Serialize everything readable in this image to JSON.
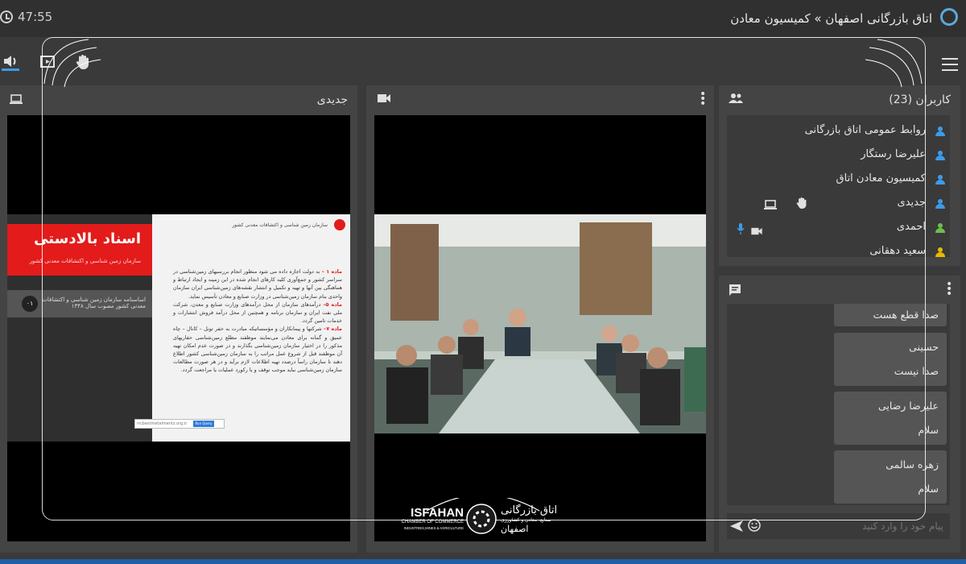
{
  "header": {
    "timer": "47:55",
    "title": "اتاق بازرگانی اصفهان » کمیسیون معادن"
  },
  "toolbar": {
    "audio_icon": "speaker-icon",
    "screenshare_icon": "screen-share-icon",
    "hand_icon": "raise-hand-icon",
    "menu_icon": "hamburger-icon"
  },
  "presentation": {
    "title": "جدیدی",
    "slide": {
      "big_title": "اسناد بالادستی",
      "red_subtitle": "سازمان زمین شناسی و اکتشافات معدنی کشور",
      "grey_text": "اساسنامه سازمان زمین شناسی و اکتشافات معدنی کشور مصوب سال ۱۳۴۸",
      "grey_num": "۰۱",
      "header_text": "سازمان زمین شناسی و اکتشافات معدنی کشور",
      "p1_label": "ماده ۱ –",
      "p1_text": " به دولت اجازه داده می شود منظور انجام بررسیهای زمین‌شناسی در سراسر کشور و جمع‌آوری کلیه کارهای انجام شده در این زمینه و ایجاد ارتباط و هماهنگی بین آنها و تهیه و تکمیل و انتشار نقشه‌های زمین‌شناسی ایران سازمان واحدی بنام سازمان زمین‌شناسی در وزارت صنایع و معادن تأسیس نماید.",
      "p2_label": "ماده ۵–",
      "p2_text": " درآمدهای سازمان از محل درآمدهای وزارت صنایع و معدن، شرکت ملی نفت ایران و سازمان برنامه و همچنین از محل درآمد فروش انتشارات و خدمات تامین گردد.",
      "p3_label": "ماده ۷–",
      "p3_text": " شرکتها و پیمانکاران و مؤسساتیکه مبادرت به حفر تونل – کانال – چاه عمیق و گمانه برای معادن می‌نمایند موظفند مطلع زمین‌شناسی حفاریهای مذکور را در اختیار سازمان زمین‌شناسی بگذارند و در صورت عدم امکان تهیه آن موظفند قبل از شروع عمل مراتب را به سازمان زمین‌شناسی کشور اطلاع دهند تا سازمان راساً درصدد تهیه اطلاعات لازم برآید و در هر صورت مطالعات سازمان زمین‌شناسی نباید موجب توقف و یا رکورد عملیات یا مراجعت گردد.",
      "search_text": "rrcbestmetalmentz.org.ir",
      "search_button": "Run Query"
    }
  },
  "video": {
    "camera_icon": "video-camera-icon"
  },
  "users": {
    "title": "کاربران (23)",
    "items": [
      {
        "name": "روابط عمومی اتاق بازرگانی",
        "color": "#3d9be9"
      },
      {
        "name": "علیرضا رستگار",
        "color": "#3d9be9"
      },
      {
        "name": "کمیسیون معادن اتاق",
        "color": "#3d9be9"
      },
      {
        "name": "جدیدی",
        "color": "#3d9be9"
      },
      {
        "name": "احمدی",
        "color": "#6cc04a"
      },
      {
        "name": "سعید دهقانی",
        "color": "#e6b800"
      }
    ]
  },
  "chat": {
    "messages": [
      {
        "sender": "",
        "text": "صدا قطع هست"
      },
      {
        "sender": "حسینی",
        "text": "صدا نیست"
      },
      {
        "sender": "علیرضا رضایی",
        "text": "سلام"
      },
      {
        "sender": "زهره سالمی",
        "text": "سلام"
      }
    ],
    "placeholder": "پیام خود را وارد کنید"
  },
  "brand": {
    "en_line1": "ISFAHAN",
    "en_line2": "CHAMBER OF COMMERCE",
    "en_line3": "INDUSTRIES,MINES & AGRICULTURE",
    "fa_line1": "اتاق بازرگانی",
    "fa_line2": "صنایع، معادن و کشاورزی",
    "fa_line3": "اصفهان"
  }
}
